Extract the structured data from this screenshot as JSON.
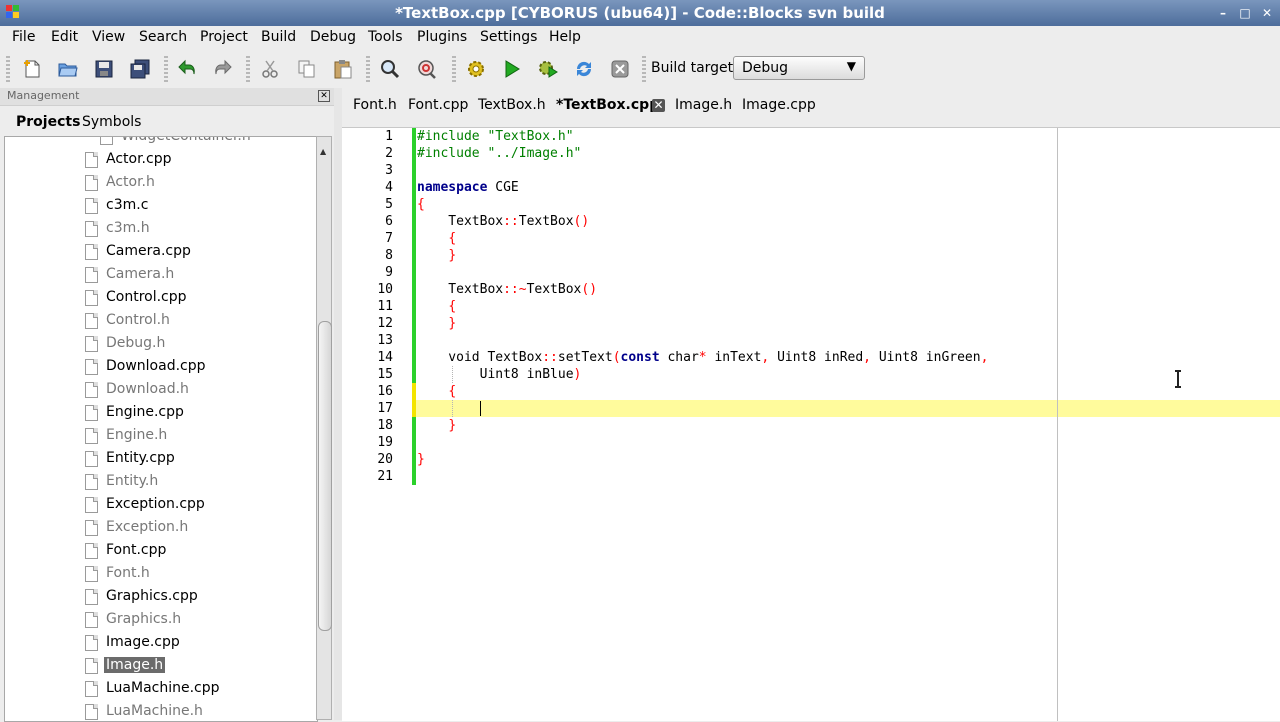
{
  "window": {
    "title": "*TextBox.cpp [CYBORUS (ubu64)] - Code::Blocks svn build",
    "controls": [
      "–",
      "□",
      "✕"
    ]
  },
  "menu": [
    "File",
    "Edit",
    "View",
    "Search",
    "Project",
    "Build",
    "Debug",
    "Tools",
    "Plugins",
    "Settings",
    "Help"
  ],
  "toolbar": {
    "build_target_label": "Build target:",
    "build_target_value": "Debug",
    "arrow": "▼"
  },
  "management": {
    "header": "Management",
    "close": "✕",
    "tabs": [
      "Projects",
      "Symbols"
    ],
    "files": [
      {
        "name": "WidgetContainer.h",
        "type": "h"
      },
      {
        "name": "Actor.cpp",
        "type": "cpp"
      },
      {
        "name": "Actor.h",
        "type": "h"
      },
      {
        "name": "c3m.c",
        "type": "cpp"
      },
      {
        "name": "c3m.h",
        "type": "h"
      },
      {
        "name": "Camera.cpp",
        "type": "cpp"
      },
      {
        "name": "Camera.h",
        "type": "h"
      },
      {
        "name": "Control.cpp",
        "type": "cpp"
      },
      {
        "name": "Control.h",
        "type": "h"
      },
      {
        "name": "Debug.h",
        "type": "h"
      },
      {
        "name": "Download.cpp",
        "type": "cpp"
      },
      {
        "name": "Download.h",
        "type": "h"
      },
      {
        "name": "Engine.cpp",
        "type": "cpp"
      },
      {
        "name": "Engine.h",
        "type": "h"
      },
      {
        "name": "Entity.cpp",
        "type": "cpp"
      },
      {
        "name": "Entity.h",
        "type": "h"
      },
      {
        "name": "Exception.cpp",
        "type": "cpp"
      },
      {
        "name": "Exception.h",
        "type": "h"
      },
      {
        "name": "Font.cpp",
        "type": "cpp"
      },
      {
        "name": "Font.h",
        "type": "h"
      },
      {
        "name": "Graphics.cpp",
        "type": "cpp"
      },
      {
        "name": "Graphics.h",
        "type": "h"
      },
      {
        "name": "Image.cpp",
        "type": "cpp"
      },
      {
        "name": "Image.h",
        "type": "h",
        "selected": true
      },
      {
        "name": "LuaMachine.cpp",
        "type": "cpp"
      },
      {
        "name": "LuaMachine.h",
        "type": "h"
      }
    ]
  },
  "editor": {
    "tabs": [
      {
        "label": "Font.h"
      },
      {
        "label": "Font.cpp"
      },
      {
        "label": "TextBox.h"
      },
      {
        "label": "*TextBox.cpp",
        "active": true
      },
      {
        "label": "Image.h"
      },
      {
        "label": "Image.cpp"
      }
    ],
    "tab_close": "✕",
    "lines": [
      "#include \"TextBox.h\"",
      "#include \"../Image.h\"",
      "",
      "namespace CGE",
      "{",
      "    TextBox::TextBox()",
      "    {",
      "    }",
      "",
      "    TextBox::~TextBox()",
      "    {",
      "    }",
      "",
      "    void TextBox::setText(const char* inText, Uint8 inRed, Uint8 inGreen,",
      "        Uint8 inBlue)",
      "    {",
      "        ",
      "    }",
      "",
      "}",
      ""
    ]
  }
}
